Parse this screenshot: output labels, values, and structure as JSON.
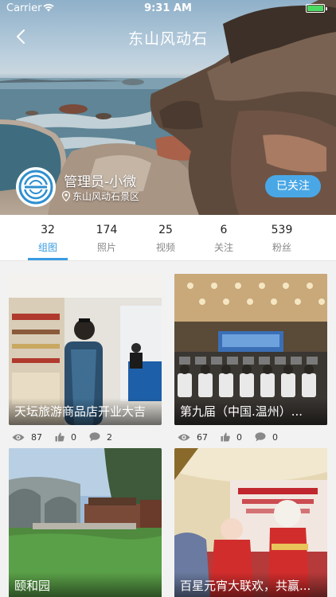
{
  "status_bar": {
    "carrier": "Carrier",
    "time": "9:31 AM"
  },
  "nav": {
    "title": "东山风动石"
  },
  "profile": {
    "name": "管理员-小微",
    "location": "东山风动石景区",
    "follow_label": "已关注"
  },
  "stats": [
    {
      "count": "32",
      "label": "组图",
      "active": true
    },
    {
      "count": "174",
      "label": "照片"
    },
    {
      "count": "25",
      "label": "视频"
    },
    {
      "count": "6",
      "label": "关注"
    },
    {
      "count": "539",
      "label": "粉丝"
    }
  ],
  "cards": [
    {
      "title": "天坛旅游商品店开业大吉",
      "views": "87",
      "likes": "0",
      "comments": "2"
    },
    {
      "title": "第九届（中国.温州）...",
      "views": "67",
      "likes": "0",
      "comments": "0"
    },
    {
      "title": "颐和园",
      "views": "",
      "likes": "",
      "comments": ""
    },
    {
      "title": "百星元宵大联欢，共赢...",
      "views": "",
      "likes": "",
      "comments": ""
    }
  ],
  "colors": {
    "accent": "#3a9be0",
    "follow_button": "#4aa7e6",
    "battery": "#4cd964"
  },
  "icons": [
    "back-chevron-icon",
    "wifi-icon",
    "battery-icon",
    "location-pin-icon",
    "eye-icon",
    "thumbs-up-icon",
    "comment-icon"
  ]
}
